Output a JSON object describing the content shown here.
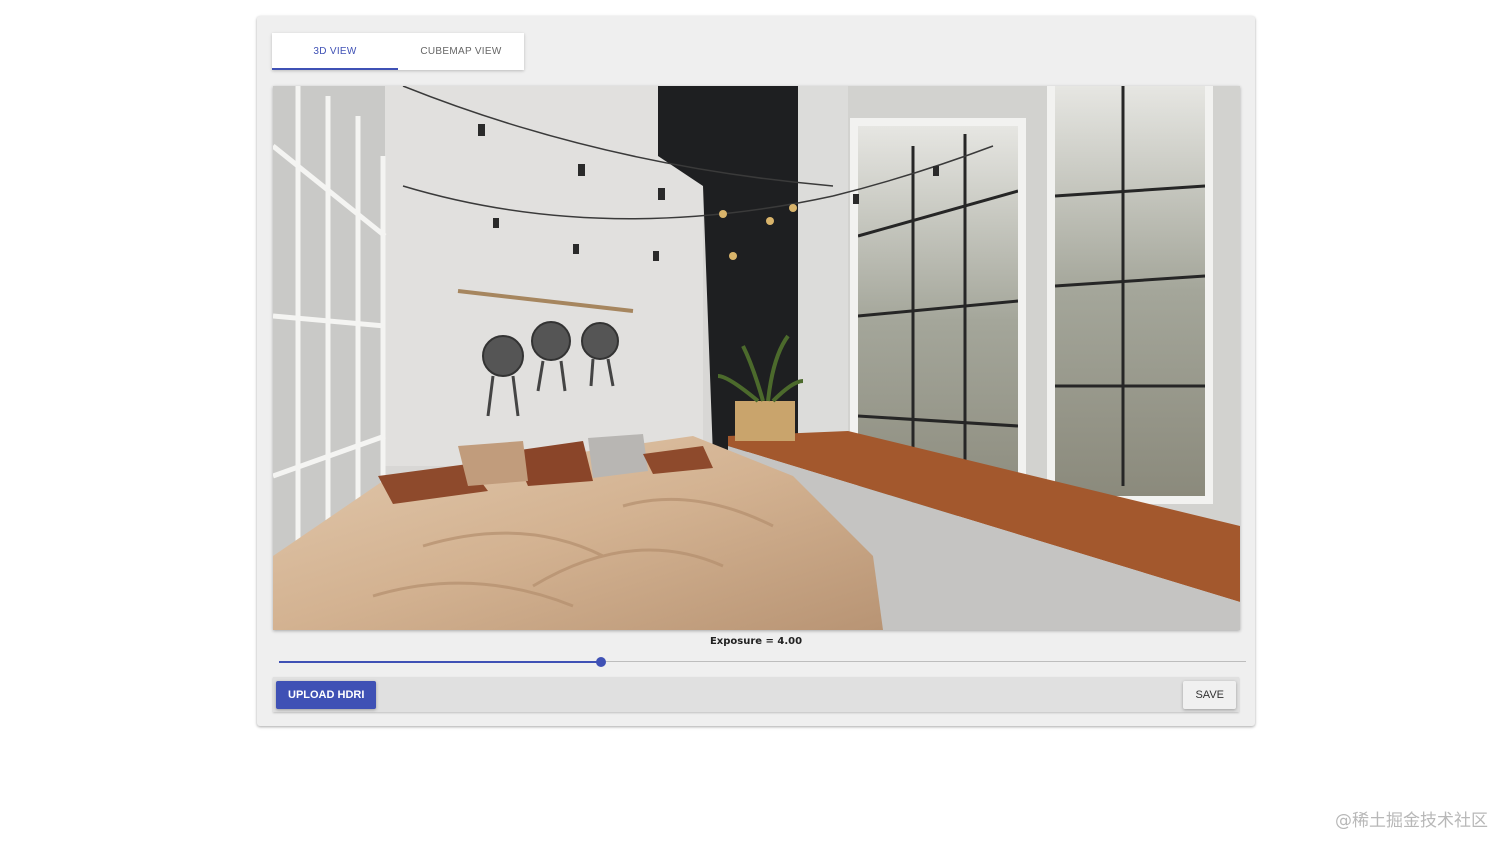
{
  "tabs": [
    {
      "label": "3D VIEW",
      "active": true
    },
    {
      "label": "CUBEMAP VIEW",
      "active": false
    }
  ],
  "viewer": {
    "content": "bedroom-hdri-panorama"
  },
  "exposure": {
    "label": "Exposure = 4.00",
    "fraction": 0.333
  },
  "toolbar": {
    "upload_label": "UPLOAD HDRI",
    "save_label": "SAVE"
  },
  "watermark": "@稀土掘金技术社区",
  "colors": {
    "accent": "#3f51b5",
    "panel": "#efefef",
    "toolbar": "#e0e0e0"
  }
}
